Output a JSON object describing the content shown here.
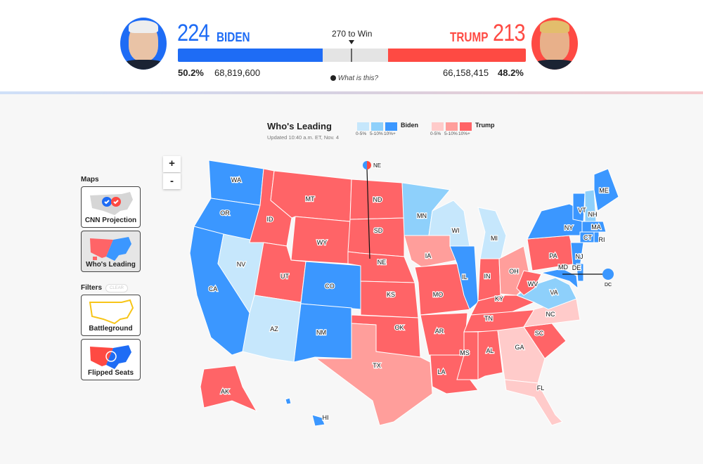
{
  "header": {
    "biden": {
      "electoral_votes": "224",
      "name": "BIDEN",
      "pct": "50.2%",
      "votes": "68,819,600",
      "color": "#1e6cf5"
    },
    "trump": {
      "electoral_votes": "213",
      "name": "TRUMP",
      "pct": "48.2%",
      "votes": "66,158,415",
      "color": "#fe4a43"
    },
    "to_win": "270 to Win",
    "what_is_this": "What is this?",
    "bar": {
      "total": 538,
      "biden": 224,
      "trump": 213
    }
  },
  "sidebar": {
    "maps_label": "Maps",
    "maps": [
      {
        "label": "CNN Projection"
      },
      {
        "label": "Who's Leading",
        "selected": true
      }
    ],
    "filters_label": "Filters",
    "clear_label": "CLEAR",
    "filters": [
      {
        "label": "Battleground"
      },
      {
        "label": "Flipped Seats"
      }
    ]
  },
  "zoom": {
    "in": "+",
    "out": "-"
  },
  "legend": {
    "title": "Who's Leading",
    "updated": "Updated 10:40 a.m. ET, Nov. 4",
    "biden_label": "Biden",
    "trump_label": "Trump",
    "bins": [
      "0-5%",
      "5-10%",
      "10%+"
    ],
    "colors": {
      "b1": "#c6e7fc",
      "b2": "#8ed0fb",
      "b3": "#3b97ff",
      "t1": "#ffcbca",
      "t2": "#ff9e9b",
      "t3": "#ff6467"
    }
  },
  "states": [
    {
      "code": "WA",
      "lean": "b3"
    },
    {
      "code": "OR",
      "lean": "b3"
    },
    {
      "code": "CA",
      "lean": "b3"
    },
    {
      "code": "NV",
      "lean": "b1"
    },
    {
      "code": "ID",
      "lean": "t3"
    },
    {
      "code": "MT",
      "lean": "t3"
    },
    {
      "code": "WY",
      "lean": "t3"
    },
    {
      "code": "UT",
      "lean": "t3"
    },
    {
      "code": "CO",
      "lean": "b3"
    },
    {
      "code": "AZ",
      "lean": "b1"
    },
    {
      "code": "NM",
      "lean": "b3"
    },
    {
      "code": "ND",
      "lean": "t3"
    },
    {
      "code": "SD",
      "lean": "t3"
    },
    {
      "code": "NE",
      "lean": "t3"
    },
    {
      "code": "KS",
      "lean": "t3"
    },
    {
      "code": "OK",
      "lean": "t3"
    },
    {
      "code": "TX",
      "lean": "t2"
    },
    {
      "code": "MN",
      "lean": "b2"
    },
    {
      "code": "IA",
      "lean": "t2"
    },
    {
      "code": "MO",
      "lean": "t3"
    },
    {
      "code": "AR",
      "lean": "t3"
    },
    {
      "code": "LA",
      "lean": "t3"
    },
    {
      "code": "WI",
      "lean": "b1"
    },
    {
      "code": "IL",
      "lean": "b3"
    },
    {
      "code": "MI",
      "lean": "b1"
    },
    {
      "code": "IN",
      "lean": "t3"
    },
    {
      "code": "OH",
      "lean": "t2"
    },
    {
      "code": "KY",
      "lean": "t3"
    },
    {
      "code": "TN",
      "lean": "t3"
    },
    {
      "code": "MS",
      "lean": "t3"
    },
    {
      "code": "AL",
      "lean": "t3"
    },
    {
      "code": "GA",
      "lean": "t1"
    },
    {
      "code": "FL",
      "lean": "t1"
    },
    {
      "code": "SC",
      "lean": "t3"
    },
    {
      "code": "NC",
      "lean": "t1"
    },
    {
      "code": "VA",
      "lean": "b2"
    },
    {
      "code": "WV",
      "lean": "t3"
    },
    {
      "code": "PA",
      "lean": "t3"
    },
    {
      "code": "NY",
      "lean": "b3"
    },
    {
      "code": "NJ",
      "lean": "b3"
    },
    {
      "code": "MD",
      "lean": "b3"
    },
    {
      "code": "DE",
      "lean": "b3"
    },
    {
      "code": "CT",
      "lean": "b3"
    },
    {
      "code": "RI",
      "lean": "b3"
    },
    {
      "code": "MA",
      "lean": "b3"
    },
    {
      "code": "VT",
      "lean": "b3"
    },
    {
      "code": "NH",
      "lean": "b2"
    },
    {
      "code": "ME",
      "lean": "b3"
    },
    {
      "code": "AK",
      "lean": "t3"
    },
    {
      "code": "HI",
      "lean": "b3"
    },
    {
      "code": "DC",
      "lean": "b3"
    }
  ]
}
